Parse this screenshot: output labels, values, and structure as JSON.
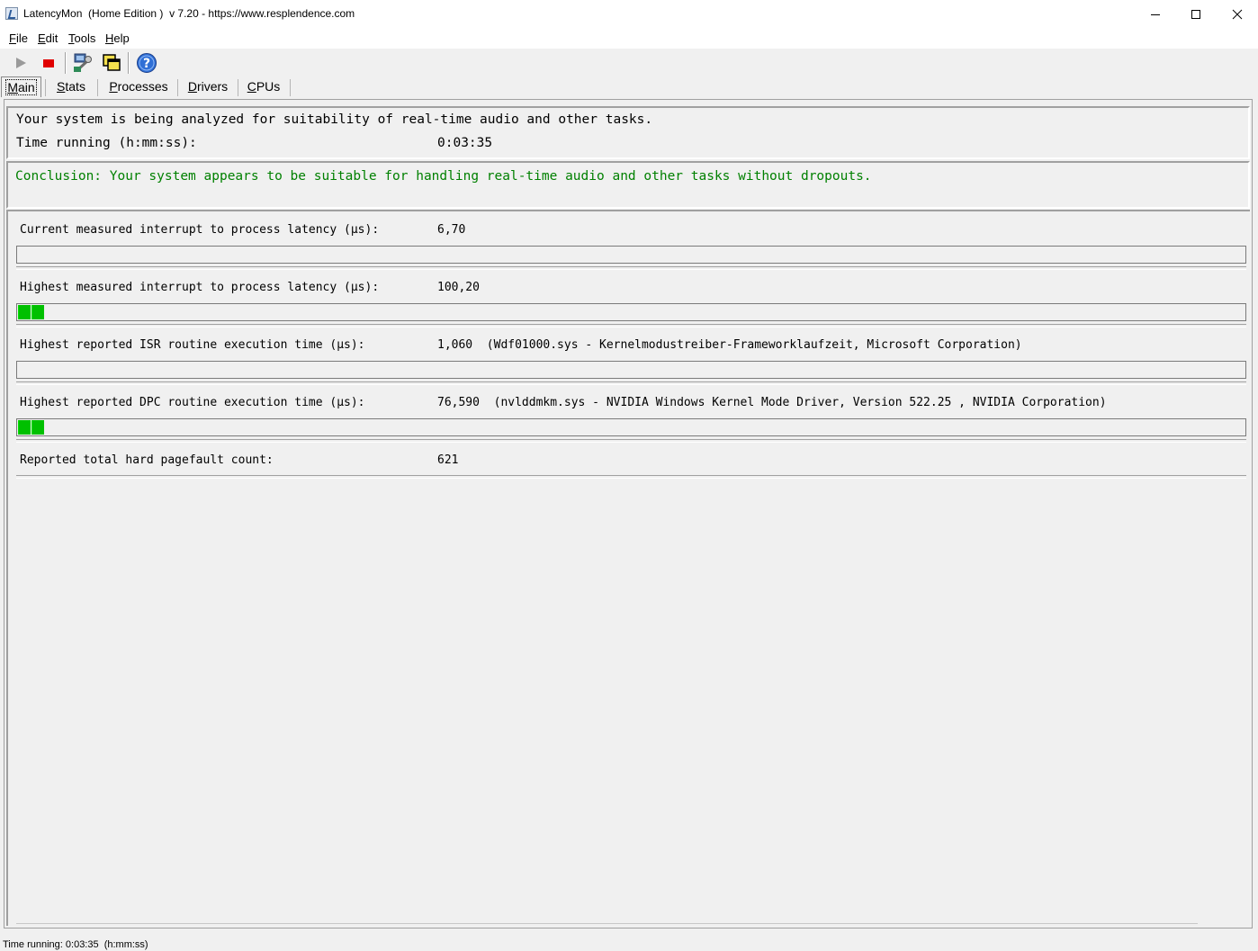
{
  "window": {
    "title": "LatencyMon  (Home Edition )  v 7.20 - https://www.resplendence.com"
  },
  "menu": {
    "file": {
      "accel": "F",
      "rest": "ile"
    },
    "edit": {
      "accel": "E",
      "rest": "dit"
    },
    "tools": {
      "accel": "T",
      "rest": "ools"
    },
    "help": {
      "accel": "H",
      "rest": "elp"
    }
  },
  "toolbar": {
    "icons": [
      "play-icon",
      "stop-icon",
      "wrench-icon",
      "windows-icon",
      "help-icon"
    ]
  },
  "tabs": [
    {
      "accel": "M",
      "rest": "ain",
      "active": true
    },
    {
      "accel": "S",
      "rest": "tats",
      "active": false
    },
    {
      "accel": "P",
      "rest": "rocesses",
      "active": false
    },
    {
      "accel": "D",
      "rest": "rivers",
      "active": false
    },
    {
      "accel": "C",
      "rest": "PUs",
      "active": false
    }
  ],
  "analysis": {
    "headline": "Your system is being analyzed for suitability of real-time audio and other tasks.",
    "time_label": "Time running (h:mm:ss):",
    "time_value": "0:03:35"
  },
  "conclusion": {
    "text": "Conclusion: Your system appears to be suitable for handling real-time audio and other tasks without dropouts.",
    "color": "#008000"
  },
  "metrics": {
    "current_latency": {
      "label": "Current measured interrupt to process latency (µs):",
      "value": "6,70",
      "blocks": 0
    },
    "highest_latency": {
      "label": "Highest measured interrupt to process latency (µs):",
      "value": "100,20",
      "blocks": 2
    },
    "isr": {
      "label": "Highest reported ISR routine execution time (µs):",
      "value": "1,060  (Wdf01000.sys - Kernelmodustreiber-Frameworklaufzeit, Microsoft Corporation)",
      "blocks": 0
    },
    "dpc": {
      "label": "Highest reported DPC routine execution time (µs):",
      "value": "76,590  (nvlddmkm.sys - NVIDIA Windows Kernel Mode Driver, Version 522.25 , NVIDIA Corporation)",
      "blocks": 2
    },
    "pagefault": {
      "label": "Reported total hard pagefault count:",
      "value": "621"
    }
  },
  "status": {
    "text": "Time running: 0:03:35  (h:mm:ss)"
  },
  "colors": {
    "bar_fill": "#00c000"
  }
}
